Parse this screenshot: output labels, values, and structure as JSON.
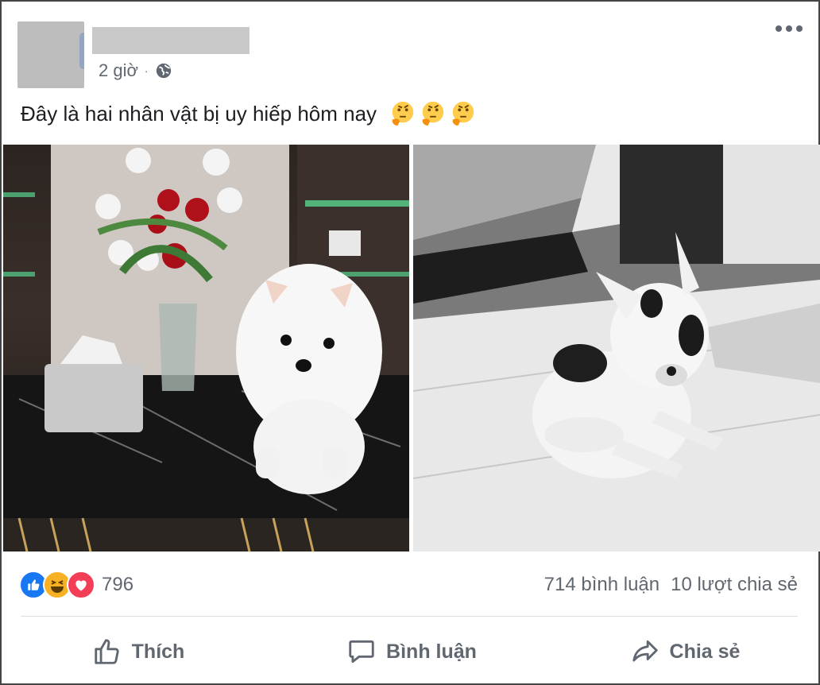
{
  "post": {
    "timestamp": "2 giờ",
    "separator": "·",
    "privacy_icon": "globe-icon",
    "more_icon": "more-options-icon",
    "caption": "Đây là hai nhân vật bị uy hiếp hôm nay",
    "caption_emojis": [
      "thinking-face",
      "thinking-face",
      "thinking-face"
    ]
  },
  "photos": [
    {
      "icon": "photo-white-pomeranian-puppy"
    },
    {
      "icon": "photo-french-bulldog-puppy"
    }
  ],
  "reactions": {
    "icons": [
      "like-icon",
      "haha-icon",
      "love-icon"
    ],
    "count": "796"
  },
  "stats": {
    "comments": "714 bình luận",
    "shares": "10 lượt chia sẻ"
  },
  "actions": {
    "like_label": "Thích",
    "comment_label": "Bình luận",
    "share_label": "Chia sẻ"
  },
  "colors": {
    "like_blue": "#1877f2",
    "haha_yellow": "#f7b125",
    "love_red": "#f33e58",
    "secondary_text": "#606770"
  }
}
